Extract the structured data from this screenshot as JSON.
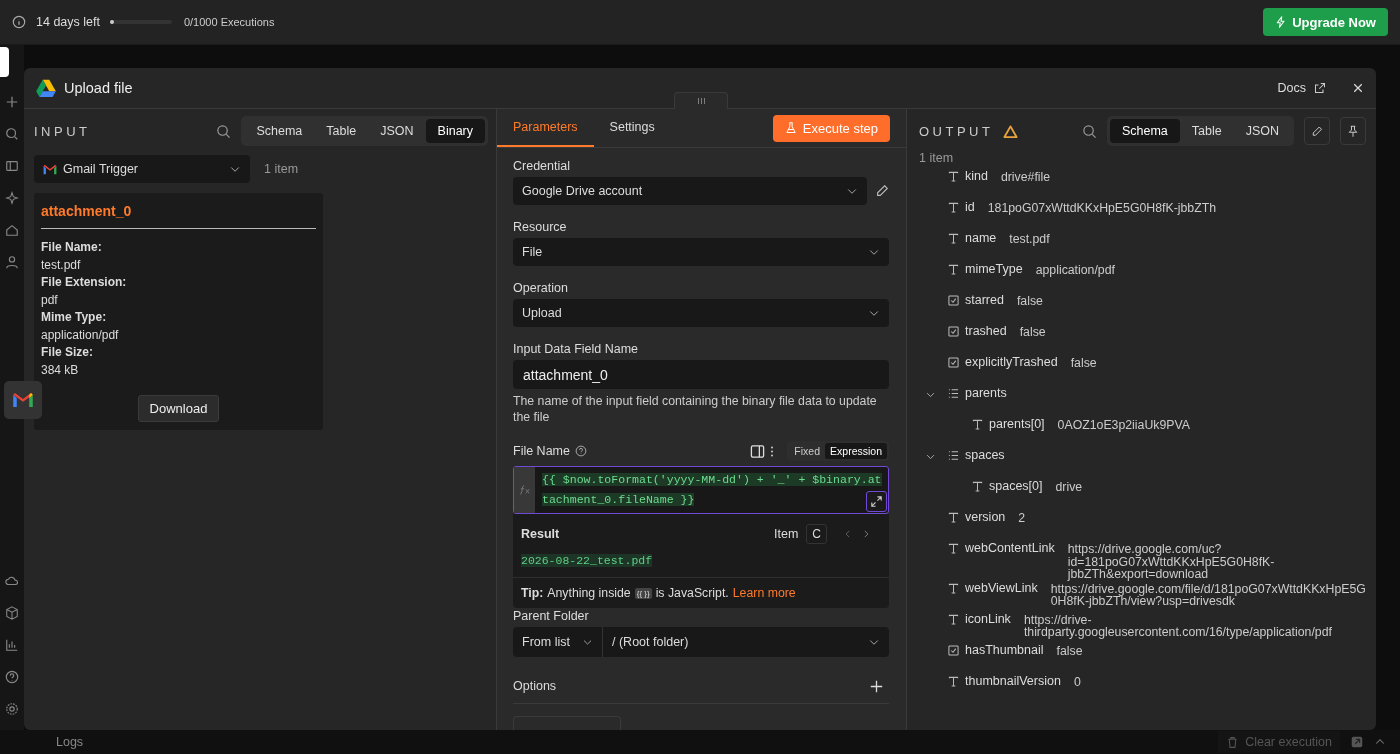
{
  "top_bar": {
    "trial_text": "14 days left",
    "progress": {
      "level": 0.03
    },
    "executions": "0/1000 Executions",
    "upgrade_button": "Upgrade Now"
  },
  "logs_bar": {
    "title": "Logs",
    "clear_button": "Clear execution"
  },
  "modal": {
    "title": "Upload file",
    "docs_link": "Docs",
    "input": {
      "title": "INPUT",
      "tabs": [
        {
          "label": "Schema",
          "selected": false
        },
        {
          "label": "Table",
          "selected": false
        },
        {
          "label": "JSON",
          "selected": false
        },
        {
          "label": "Binary",
          "selected": true
        }
      ],
      "source": "Gmail Trigger",
      "count": "1 item",
      "binary": {
        "name": "attachment_0",
        "fields": [
          {
            "label": "File Name:",
            "value": "test.pdf"
          },
          {
            "label": "File Extension:",
            "value": "pdf"
          },
          {
            "label": "Mime Type:",
            "value": "application/pdf"
          },
          {
            "label": "File Size:",
            "value": "384 kB"
          }
        ],
        "download_button": "Download"
      }
    },
    "parameters": {
      "tabs": [
        {
          "label": "Parameters",
          "selected": true
        },
        {
          "label": "Settings",
          "selected": false
        }
      ],
      "execute_button": "Execute step",
      "credential": {
        "label": "Credential",
        "value": "Google Drive account"
      },
      "resource": {
        "label": "Resource",
        "value": "File"
      },
      "operation": {
        "label": "Operation",
        "value": "Upload"
      },
      "input_field": {
        "label": "Input Data Field Name",
        "value": "attachment_0",
        "hint": "The name of the input field containing the binary file data to update the file"
      },
      "file_name": {
        "label": "File Name",
        "modes": [
          {
            "label": "Fixed",
            "selected": false
          },
          {
            "label": "Expression",
            "selected": true
          }
        ],
        "expression": "{{ $now.toFormat('yyyy-MM-dd') + '_' + $binary.attachment_0.fileName }}",
        "result_label": "Result",
        "item_label": "Item",
        "item_value": "C",
        "result": "2026-08-22_test.pdf",
        "tip_label": "Tip:",
        "tip_before": "Anything inside",
        "tip_chip": "{{ }}",
        "tip_after": "is JavaScript.",
        "tip_link": "Learn more"
      },
      "parent_folder": {
        "label": "Parent Folder",
        "mode": "From list",
        "value": "/ (Root folder)"
      },
      "options": {
        "label": "Options"
      }
    },
    "output": {
      "title": "OUTPUT",
      "warning": true,
      "tabs": [
        {
          "label": "Schema",
          "selected": true
        },
        {
          "label": "Table",
          "selected": false
        },
        {
          "label": "JSON",
          "selected": false
        }
      ],
      "count": "1 item",
      "schema": [
        {
          "kind": "string",
          "key": "kind",
          "value": "drive#file"
        },
        {
          "kind": "string",
          "key": "id",
          "value": "181poG07xWttdKKxHpE5G0H8fK-jbbZTh"
        },
        {
          "kind": "string",
          "key": "name",
          "value": "test.pdf"
        },
        {
          "kind": "string",
          "key": "mimeType",
          "value": "application/pdf"
        },
        {
          "kind": "boolean",
          "key": "starred",
          "value": "false"
        },
        {
          "kind": "boolean",
          "key": "trashed",
          "value": "false"
        },
        {
          "kind": "boolean",
          "key": "explicitlyTrashed",
          "value": "false"
        },
        {
          "kind": "array",
          "key": "parents",
          "expanded": true,
          "children": [
            {
              "kind": "string",
              "key": "parents[0]",
              "value": "0AOZ1oE3p2iiaUk9PVA"
            }
          ]
        },
        {
          "kind": "array",
          "key": "spaces",
          "expanded": true,
          "children": [
            {
              "kind": "string",
              "key": "spaces[0]",
              "value": "drive"
            }
          ]
        },
        {
          "kind": "string",
          "key": "version",
          "value": "2"
        },
        {
          "kind": "string",
          "key": "webContentLink",
          "value": "https://drive.google.com/uc?id=181poG07xWttdKKxHpE5G0H8fK-jbbZTh&export=download"
        },
        {
          "kind": "string",
          "key": "webViewLink",
          "value": "https://drive.google.com/file/d/181poG07xWttdKKxHpE5G0H8fK-jbbZTh/view?usp=drivesdk"
        },
        {
          "kind": "string",
          "key": "iconLink",
          "value": "https://drive-thirdparty.googleusercontent.com/16/type/application/pdf"
        },
        {
          "kind": "boolean",
          "key": "hasThumbnail",
          "value": "false"
        },
        {
          "kind": "string",
          "key": "thumbnailVersion",
          "value": "0"
        }
      ]
    }
  }
}
